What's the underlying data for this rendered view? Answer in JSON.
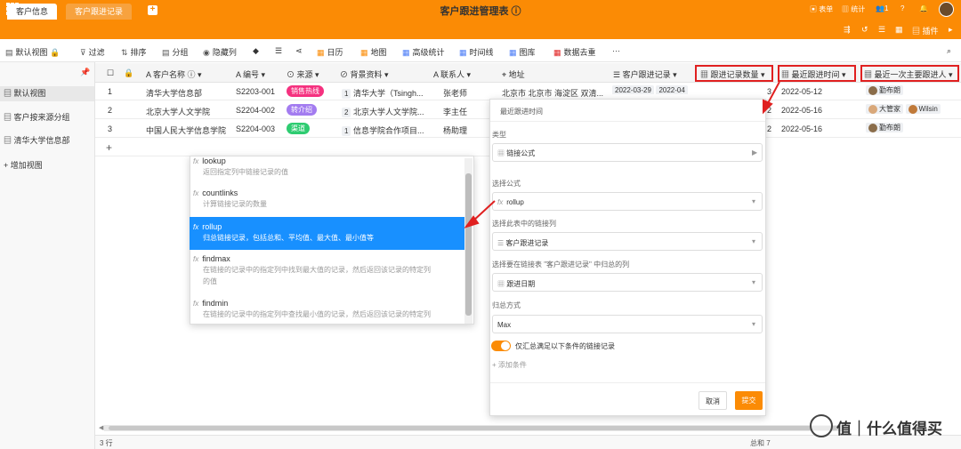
{
  "app": {
    "title": "客户跟进管理表",
    "tabs": [
      "客户信息",
      "客户跟进记录"
    ]
  },
  "topbar_right": {
    "form": "表单",
    "stats": "统计",
    "users": "1"
  },
  "toolbar2": {
    "plugin": "插件"
  },
  "toolbar": {
    "view": "默认视图",
    "filter": "过滤",
    "sort": "排序",
    "group": "分组",
    "hide": "隐藏列",
    "calendar": "日历",
    "map": "地图",
    "stats": "高级统计",
    "timeline": "时间线",
    "gallery": "图库",
    "dedupe": "数据去重",
    "more": "···"
  },
  "sidebar": {
    "items": [
      "默认视图",
      "客户按来源分组",
      "清华大学信息部"
    ],
    "add": "增加视图"
  },
  "columns": [
    "客户名称",
    "编号",
    "来源",
    "背景资料",
    "联系人",
    "地址",
    "客户跟进记录",
    "跟进记录数量",
    "最近跟进时间",
    "最近一次主要跟进人"
  ],
  "rows": [
    {
      "no": "1",
      "name": "清华大学信息部",
      "code": "S2203-001",
      "source": "销售热线",
      "source_color": "#f5317f",
      "bg_count": "1",
      "bg": "清华大学（Tsingh...",
      "contact": "张老师",
      "addr": "北京市 北京市 海淀区 双清...",
      "records": [
        "2022-03-29",
        "2022-04"
      ],
      "count": "3",
      "last": "2022-05-12",
      "people": [
        "勤布朗"
      ]
    },
    {
      "no": "2",
      "name": "北京大学人文学院",
      "code": "S2204-002",
      "source": "转介绍",
      "source_color": "#a37cf0",
      "bg_count": "2",
      "bg": "北京大学人文学院...",
      "contact": "李主任",
      "addr": "",
      "records": [],
      "count": "2",
      "last": "2022-05-16",
      "people": [
        "大管家",
        "Wilsin"
      ]
    },
    {
      "no": "3",
      "name": "中国人民大学信息学院",
      "code": "S2204-003",
      "source": "渠道",
      "source_color": "#2ecc71",
      "bg_count": "1",
      "bg": "信息学院合作项目...",
      "contact": "杨助理",
      "addr": "",
      "records": [],
      "count": "2",
      "last": "2022-05-16",
      "people": [
        "勤布朗"
      ]
    }
  ],
  "add_row": "+",
  "dropdown": {
    "options": [
      {
        "name": "lookup",
        "desc": "返回指定列中链接记录的值"
      },
      {
        "name": "countlinks",
        "desc": "计算链接记录的数量"
      },
      {
        "name": "rollup",
        "desc": "归总链接记录，包括总和、平均值、最大值、最小值等"
      },
      {
        "name": "findmax",
        "desc": "在链接的记录中的指定列中找到最大值的记录，然后返回该记录的特定列",
        "desc2": "的值"
      },
      {
        "name": "findmin",
        "desc": "在链接的记录中的指定列中查找最小值的记录，然后返回该记录的特定列"
      }
    ],
    "selected": "rollup"
  },
  "panel": {
    "title": "最近跟进时间",
    "type_label": "类型",
    "type_value": "链接公式",
    "formula_label": "选择公式",
    "formula_value": "rollup",
    "link_label": "选择此表中的链接列",
    "link_value": "客户跟进记录",
    "col_label": "选择要在链接表 \"客户跟进记录\" 中归总的列",
    "col_value": "跟进日期",
    "agg_label": "归总方式",
    "agg_value": "Max",
    "toggle_label": "仅汇总满足以下条件的链接记录",
    "add_cond": "添加条件",
    "cancel": "取消",
    "submit": "提交"
  },
  "footer": {
    "rows": "3 行",
    "sum": "总和 7"
  },
  "watermark": "值｜什么值得买",
  "colors": {
    "accent": "#fb8b05",
    "selected": "#1890ff",
    "red": "#e02020"
  }
}
